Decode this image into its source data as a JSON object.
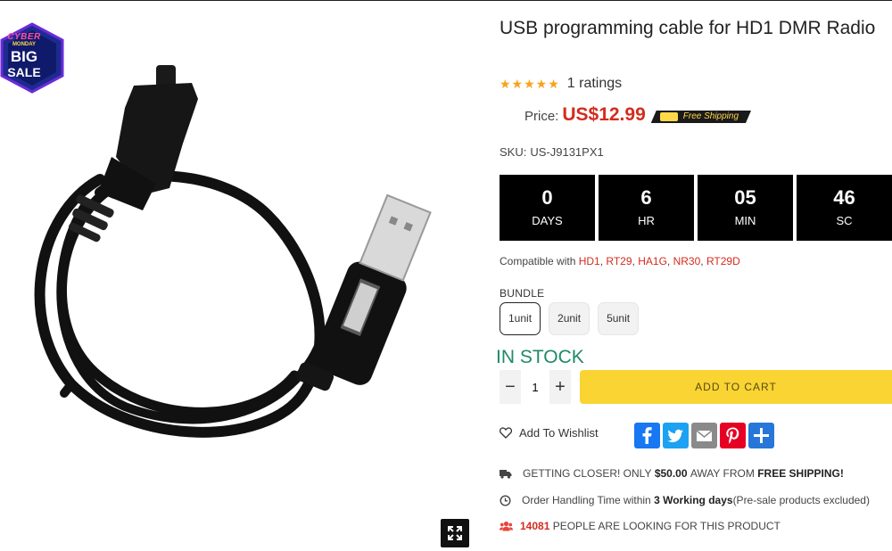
{
  "badge": {
    "line1": "CYBER",
    "line2": "MONDAY",
    "line3": "BIG",
    "line4": "SALE"
  },
  "product": {
    "title": "USB programming cable for HD1 DMR Radio",
    "stars": "★★★★★",
    "rating_count": "1 ratings",
    "price_label": "Price:",
    "price": "US$12.99",
    "free_shipping": "Free Shipping",
    "sku_label": "SKU:",
    "sku": "US-J9131PX1"
  },
  "countdown": [
    {
      "value": "0",
      "unit": "DAYS"
    },
    {
      "value": "6",
      "unit": "HR"
    },
    {
      "value": "05",
      "unit": "MIN"
    },
    {
      "value": "46",
      "unit": "SC"
    }
  ],
  "compat": {
    "prefix": "Compatible with",
    "models": [
      "HD1",
      "RT29",
      "HA1G",
      "NR30",
      "RT29D"
    ]
  },
  "bundle": {
    "label": "BUNDLE",
    "options": [
      "1unit",
      "2unit",
      "5unit"
    ],
    "selected": "1unit"
  },
  "stock": "IN STOCK",
  "quantity": {
    "minus": "−",
    "value": "1",
    "plus": "+"
  },
  "cart_label": "ADD TO CART",
  "wishlist_label": "Add To Wishlist",
  "share": [
    "facebook-icon",
    "twitter-icon",
    "email-icon",
    "pinterest-icon",
    "more-icon"
  ],
  "shipping_line": {
    "pre": "GETTING CLOSER! ONLY",
    "amount": "$50.00",
    "mid": "AWAY FROM",
    "bold": "FREE SHIPPING!"
  },
  "handling_line": {
    "pre": "Order Handling Time within",
    "bold": "3 Working days",
    "post": "(Pre-sale products excluded)"
  },
  "viewers_line": {
    "count": "14081",
    "text": "PEOPLE ARE LOOKING FOR THIS PRODUCT"
  },
  "colors": {
    "price_red": "#d42b1e",
    "stock_green": "#1f8a64",
    "cart_yellow": "#f9d433",
    "star_orange": "#f7a31a",
    "facebook": "#1877f2",
    "twitter": "#1da1f2",
    "email": "#8a8a8a",
    "pinterest": "#e60023",
    "share": "#2677d9"
  }
}
